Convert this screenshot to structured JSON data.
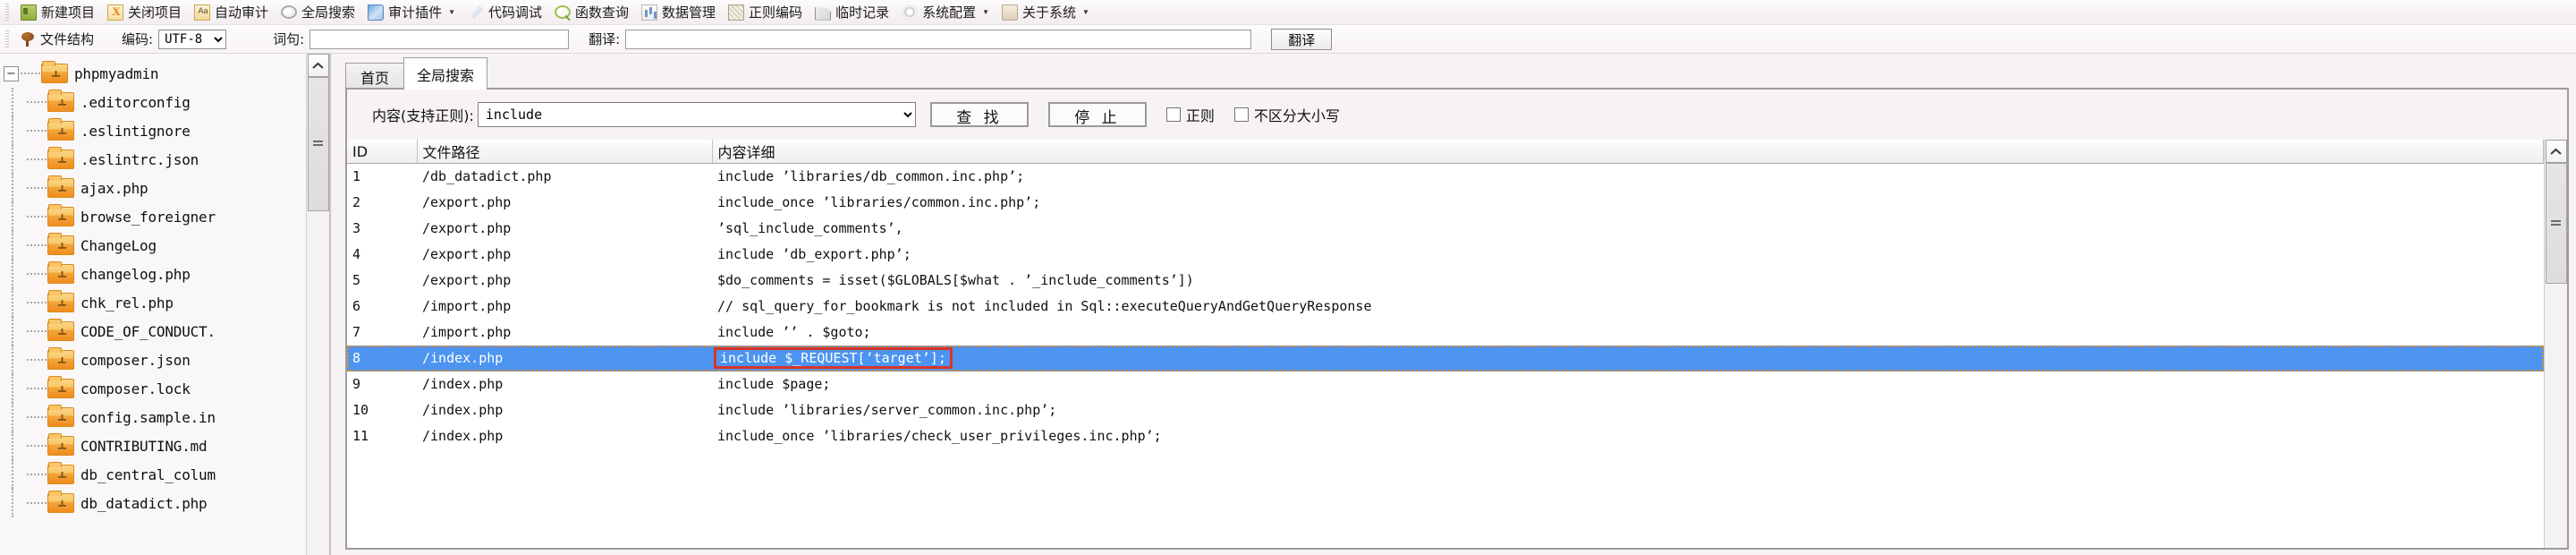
{
  "toolbar": {
    "items": [
      {
        "label": "新建项目",
        "icon": "new-project-icon",
        "caret": false
      },
      {
        "label": "关闭项目",
        "icon": "close-project-icon",
        "caret": false
      },
      {
        "label": "自动审计",
        "icon": "auto-audit-icon",
        "caret": false
      },
      {
        "label": "全局搜索",
        "icon": "global-search-icon",
        "caret": false
      },
      {
        "label": "审计插件",
        "icon": "audit-plugin-icon",
        "caret": true
      },
      {
        "label": "代码调试",
        "icon": "code-debug-icon",
        "caret": false
      },
      {
        "label": "函数查询",
        "icon": "function-query-icon",
        "caret": false
      },
      {
        "label": "数据管理",
        "icon": "data-manage-icon",
        "caret": false
      },
      {
        "label": "正则编码",
        "icon": "regex-encode-icon",
        "caret": false
      },
      {
        "label": "临时记录",
        "icon": "temp-record-icon",
        "caret": false
      },
      {
        "label": "系统配置",
        "icon": "system-config-icon",
        "caret": true
      },
      {
        "label": "关于系统",
        "icon": "about-system-icon",
        "caret": true
      }
    ]
  },
  "toolbar2": {
    "file_structure_label": "文件结构",
    "encoding_label": "编码:",
    "encoding_value": "UTF-8",
    "encoding_options": [
      "UTF-8"
    ],
    "phrase_label": "词句:",
    "phrase_value": "",
    "translate_label": "翻译:",
    "translate_value": "",
    "translate_button": "翻译"
  },
  "tree": {
    "root": {
      "label": "phpmyadmin",
      "expander": "−"
    },
    "items": [
      {
        "label": ".editorconfig"
      },
      {
        "label": ".eslintignore"
      },
      {
        "label": ".eslintrc.json"
      },
      {
        "label": "ajax.php"
      },
      {
        "label": "browse_foreigner"
      },
      {
        "label": "ChangeLog"
      },
      {
        "label": "changelog.php"
      },
      {
        "label": "chk_rel.php"
      },
      {
        "label": "CODE_OF_CONDUCT."
      },
      {
        "label": "composer.json"
      },
      {
        "label": "composer.lock"
      },
      {
        "label": "config.sample.in"
      },
      {
        "label": "CONTRIBUTING.md"
      },
      {
        "label": "db_central_colum"
      },
      {
        "label": "db_datadict.php"
      }
    ]
  },
  "tabs": [
    {
      "label": "首页",
      "active": false
    },
    {
      "label": "全局搜索",
      "active": true
    }
  ],
  "search": {
    "content_label": "内容(支持正则):",
    "content_value": "include",
    "content_options": [
      "include"
    ],
    "find_button": "查 找",
    "stop_button": "停 止",
    "regex_checkbox_label": "正则",
    "regex_checked": false,
    "ignorecase_checkbox_label": "不区分大小写",
    "ignorecase_checked": false
  },
  "results": {
    "columns": [
      "ID",
      "文件路径",
      "内容详细"
    ],
    "selected_id": "8",
    "highlight_color": "#d8342a",
    "selection_color": "#4d94f0",
    "rows": [
      {
        "id": "1",
        "path": "/db_datadict.php",
        "detail": "include ’libraries/db_common.inc.php’;",
        "selected": false,
        "highlight": false
      },
      {
        "id": "2",
        "path": "/export.php",
        "detail": "include_once ’libraries/common.inc.php’;",
        "selected": false,
        "highlight": false
      },
      {
        "id": "3",
        "path": "/export.php",
        "detail": "’sql_include_comments’,",
        "selected": false,
        "highlight": false
      },
      {
        "id": "4",
        "path": "/export.php",
        "detail": "include ’db_export.php’;",
        "selected": false,
        "highlight": false
      },
      {
        "id": "5",
        "path": "/export.php",
        "detail": "$do_comments = isset($GLOBALS[$what . ’_include_comments’])",
        "selected": false,
        "highlight": false
      },
      {
        "id": "6",
        "path": "/import.php",
        "detail": "// sql_query_for_bookmark is not included in Sql::executeQueryAndGetQueryResponse",
        "selected": false,
        "highlight": false
      },
      {
        "id": "7",
        "path": "/import.php",
        "detail": "include ’’ . $goto;",
        "selected": false,
        "highlight": false
      },
      {
        "id": "8",
        "path": "/index.php",
        "detail": "include $_REQUEST[’target’];",
        "selected": true,
        "highlight": true
      },
      {
        "id": "9",
        "path": "/index.php",
        "detail": "include $page;",
        "selected": false,
        "highlight": false
      },
      {
        "id": "10",
        "path": "/index.php",
        "detail": "include ’libraries/server_common.inc.php’;",
        "selected": false,
        "highlight": false
      },
      {
        "id": "11",
        "path": "/index.php",
        "detail": "include_once ’libraries/check_user_privileges.inc.php’;",
        "selected": false,
        "highlight": false
      }
    ]
  },
  "scrollbars": {
    "up_arrow": "⌃"
  }
}
